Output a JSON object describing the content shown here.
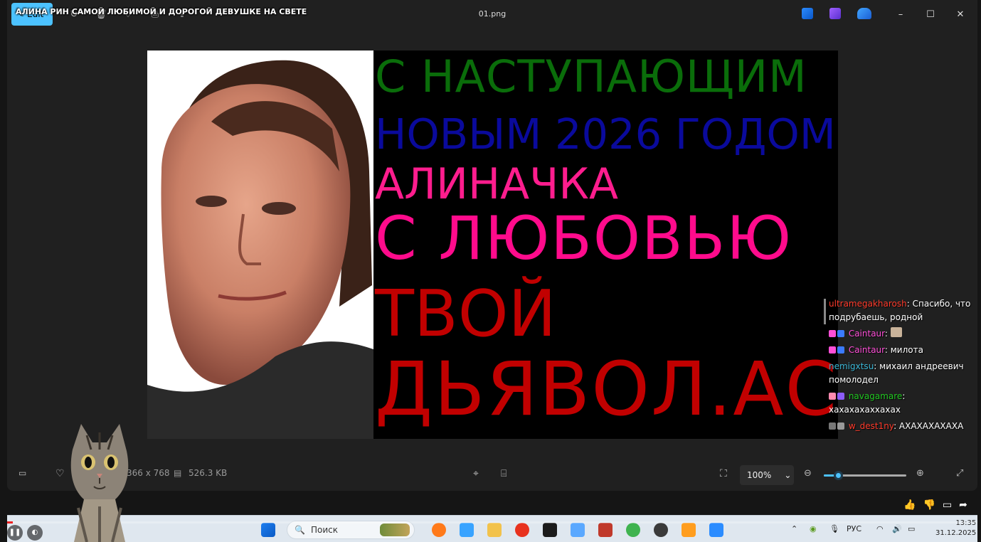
{
  "stream_title": "АЛИНА РИН САМОЙ ЛЮБИМОЙ И ДОРОГОЙ ДЕВУШКЕ НА СВЕТЕ",
  "viewer": {
    "edit_label": "Edit",
    "file_name": "01.png",
    "window_controls": {
      "minimize": "–",
      "maximize": "☐",
      "close": "✕"
    },
    "dimensions": "366 x 768",
    "file_size": "526.3 KB",
    "zoom_value": "100%",
    "zoom_fraction": 0.17
  },
  "greeting": {
    "line1": "С НАСТУПАЮЩИМ",
    "line2": "НОВЫМ 2026 ГОДОМ",
    "line3": "АЛИНАЧКА",
    "line4": "С ЛЮБОВЬЮ",
    "line5": "ТВОЙ",
    "line6": "ДЬЯВОЛ.АС",
    "colors": {
      "line1": "#0a6d0a",
      "line2": "#0a0a9c",
      "line3": "#ff1d8e",
      "line4": "#ff0b8c",
      "line5": "#c10000",
      "line6": "#c10000"
    }
  },
  "chat": [
    {
      "user": "ultramegakharosh",
      "user_color": "#ff3b2b",
      "text": ": Спасибо, что подрубаешь, родной"
    },
    {
      "user": "Caintaur",
      "user_color": "#ff4fd8",
      "text": ":"
    },
    {
      "user": "Caintaur",
      "user_color": "#ff4fd8",
      "text": ": милота"
    },
    {
      "user": "nemigxtsu",
      "user_color": "#3bb7d6",
      "text": ": михаил андреевич помолодел"
    },
    {
      "user": "navagamare",
      "user_color": "#22c822",
      "text": ": хахахахаххахах"
    },
    {
      "user": "w_dest1ny",
      "user_color": "#ff3b2b",
      "text": ": АХАХАХАХАХА"
    }
  ],
  "taskbar": {
    "search_placeholder": "Поиск",
    "language": "РУС",
    "time": "13:35",
    "date": "31.12.2025"
  },
  "stream": {
    "progress_fraction": 0.006,
    "reactions": [
      "like-icon",
      "dislike-icon",
      "comment-icon",
      "share-icon"
    ]
  }
}
